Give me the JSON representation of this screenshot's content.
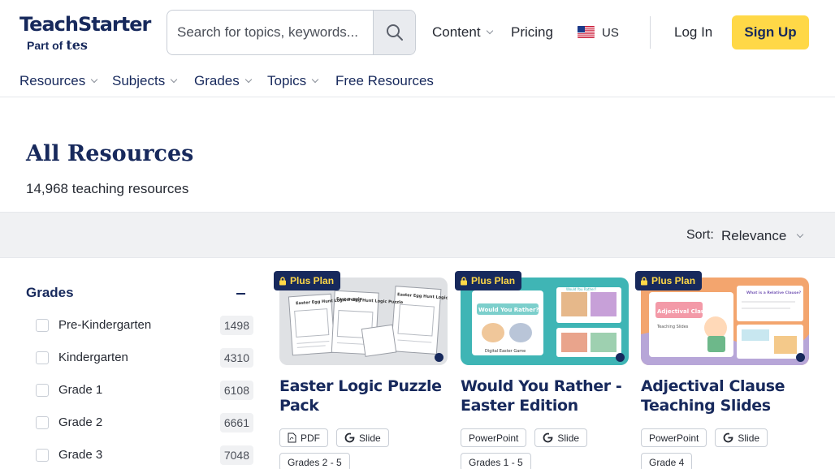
{
  "header": {
    "brand_name": "TeachStarter",
    "brand_part_of": "Part of",
    "brand_parent": "tes",
    "search_placeholder": "Search for topics, keywords...",
    "content_label": "Content",
    "pricing_label": "Pricing",
    "locale_label": "US",
    "login_label": "Log In",
    "signup_label": "Sign Up"
  },
  "secondary_nav": {
    "resources": "Resources",
    "subjects": "Subjects",
    "grades": "Grades",
    "topics": "Topics",
    "free_resources": "Free Resources"
  },
  "page": {
    "title": "All Resources",
    "count_text": "14,968 teaching resources"
  },
  "sort": {
    "label": "Sort:",
    "value": "Relevance"
  },
  "filters": {
    "grades_heading": "Grades",
    "items": [
      {
        "label": "Pre-Kindergarten",
        "count": "1498"
      },
      {
        "label": "Kindergarten",
        "count": "4310"
      },
      {
        "label": "Grade 1",
        "count": "6108"
      },
      {
        "label": "Grade 2",
        "count": "6661"
      },
      {
        "label": "Grade 3",
        "count": "7048"
      }
    ]
  },
  "cards": [
    {
      "badge": "Plus Plan",
      "title": "Easter Logic Puzzle Pack",
      "formats": [
        "PDF",
        "Slide"
      ],
      "grades": "Grades 2 - 5",
      "thumb_texts": [
        "Easter Egg Hunt Logic Puzzle",
        "Easter Egg Hunt Logic Puzzle",
        "Easter Egg Hunt Logic Puzzle"
      ]
    },
    {
      "badge": "Plus Plan",
      "title": "Would You Rather - Easter Edition",
      "formats": [
        "PowerPoint",
        "Slide"
      ],
      "grades": "Grades 1 - 5",
      "thumb_texts": [
        "Would You Rather?",
        "Digital Easter Game",
        "Would You Rather?"
      ]
    },
    {
      "badge": "Plus Plan",
      "title": "Adjectival Clause Teaching Slides",
      "formats": [
        "PowerPoint",
        "Slide"
      ],
      "grades": "Grade 4",
      "thumb_texts": [
        "Adjectival Clauses",
        "Teaching Slides",
        "What is a Relative Clause?"
      ]
    }
  ],
  "colors": {
    "navy": "#17295c",
    "accent_yellow": "#ffd847",
    "card1_bg": "#dfe1e4",
    "card2_bg": "#3fb5b5",
    "card3_bg": "#f3a56e"
  },
  "icons": {
    "search": "search-icon",
    "lock": "lock-icon",
    "pdf": "pdf-icon",
    "google_slides": "google-g-icon",
    "flag": "us-flag-icon"
  }
}
